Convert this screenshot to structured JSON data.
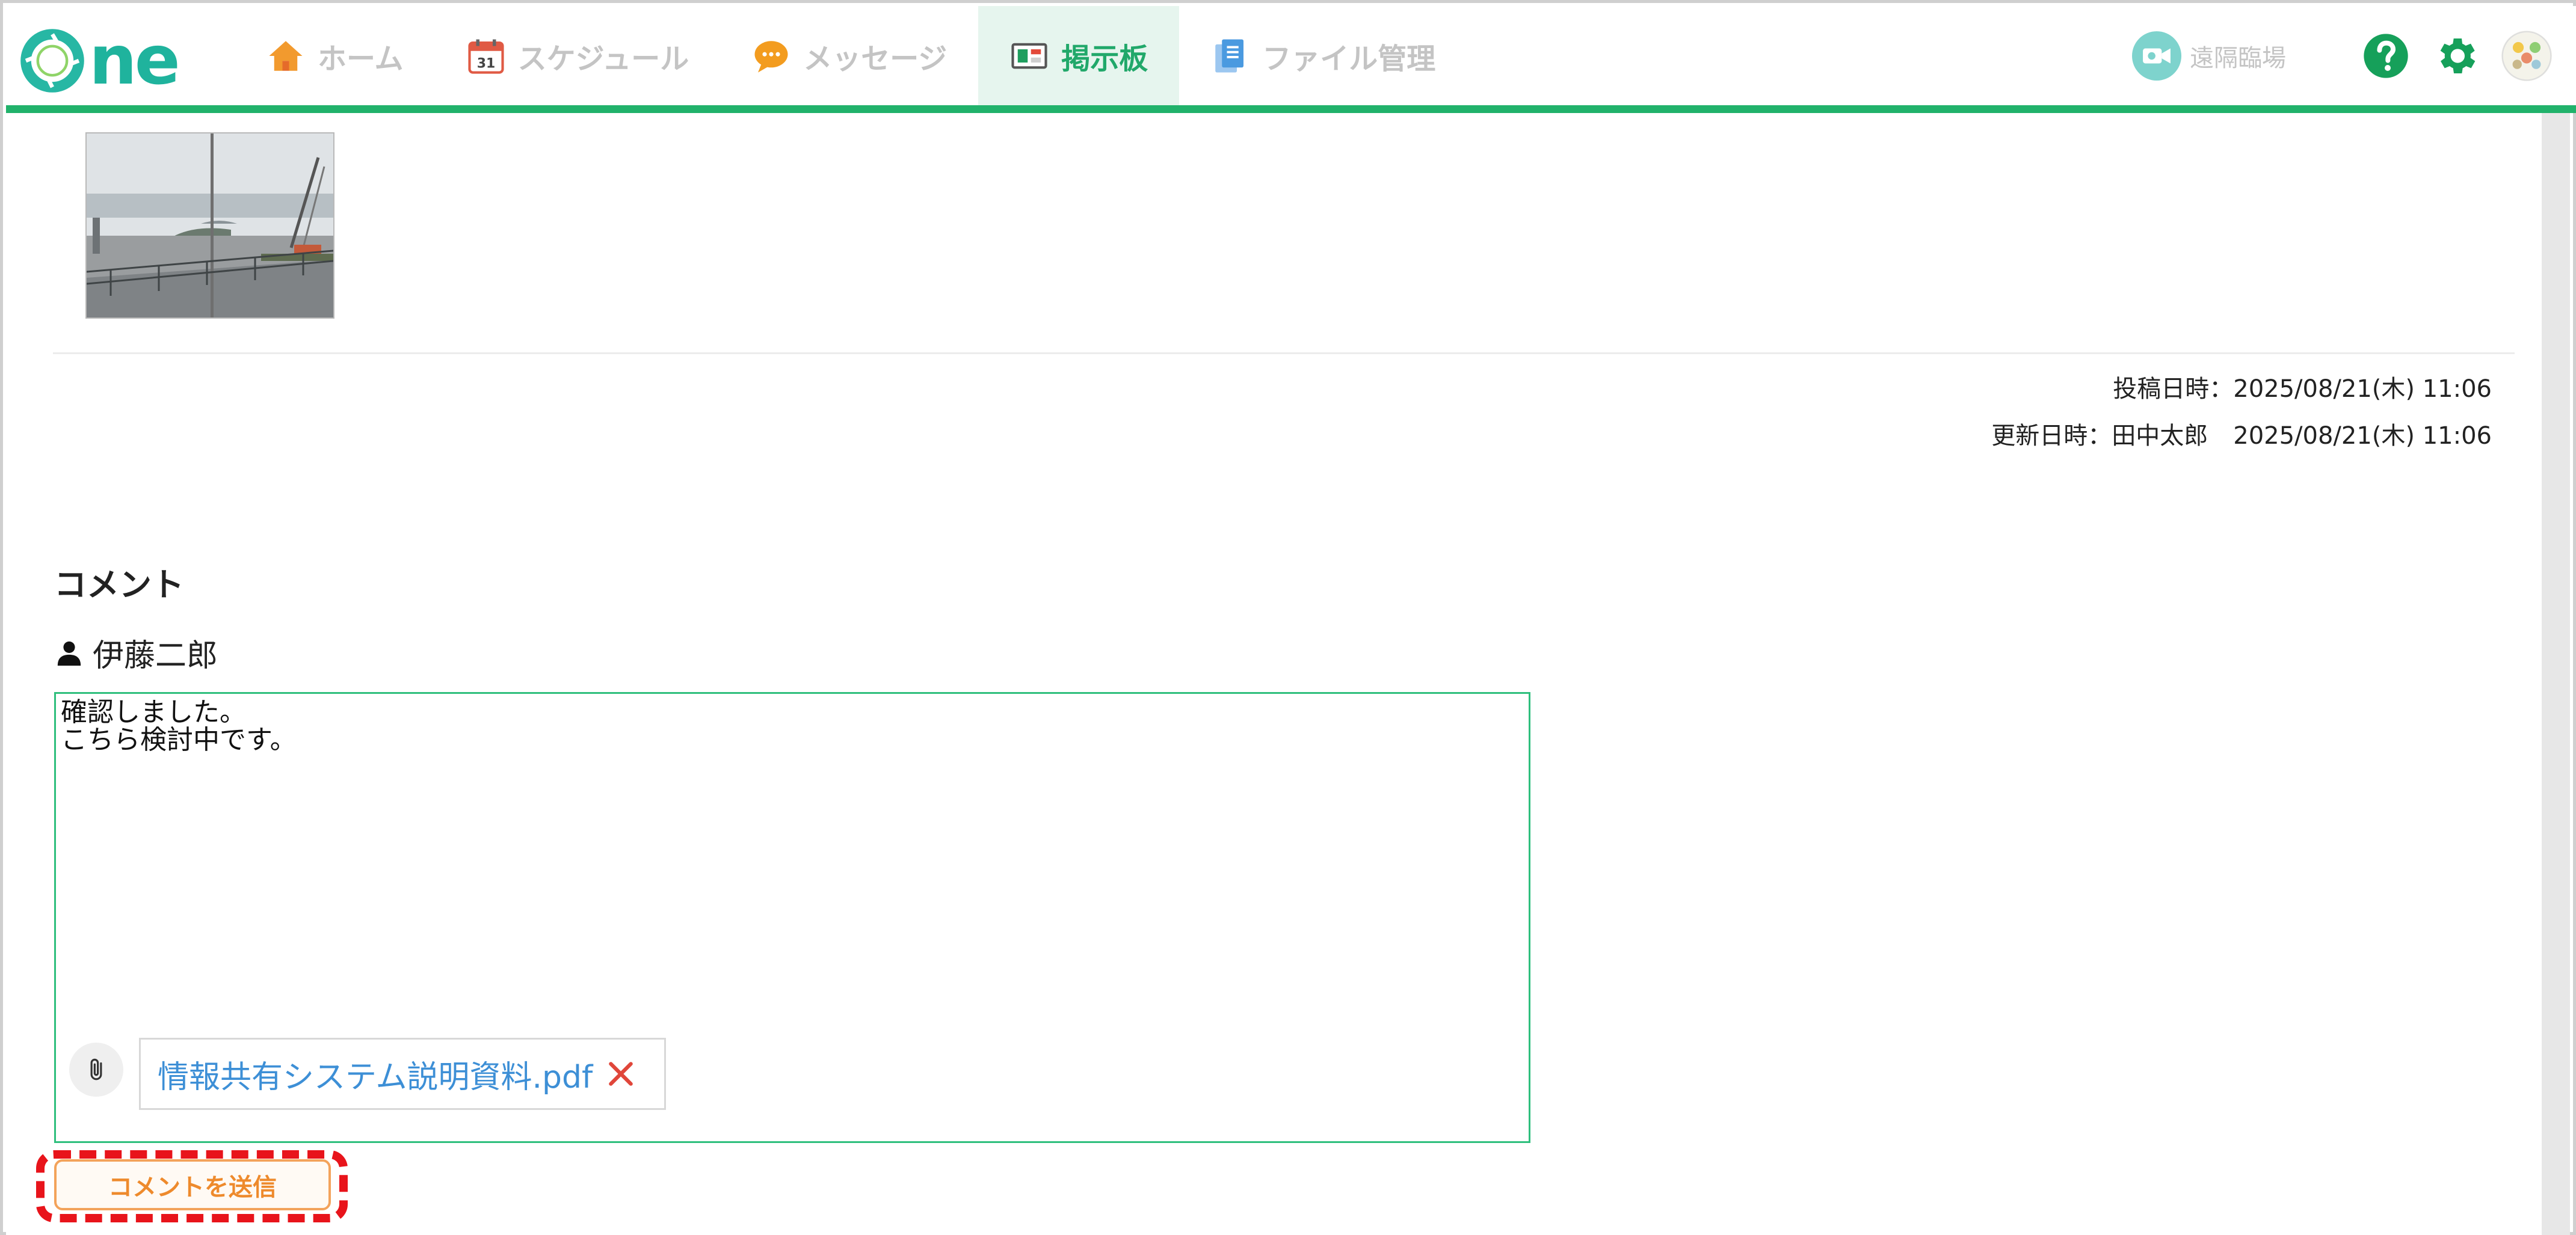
{
  "app": {
    "logo_text": "ne"
  },
  "nav": {
    "items": [
      {
        "label": "ホーム",
        "icon": "house-icon"
      },
      {
        "label": "スケジュール",
        "icon": "calendar-icon",
        "calendar_day": "31"
      },
      {
        "label": "メッセージ",
        "icon": "chat-bubble-icon"
      },
      {
        "label": "掲示板",
        "icon": "bulletin-board-icon",
        "active": true
      },
      {
        "label": "ファイル管理",
        "icon": "documents-icon"
      }
    ]
  },
  "header_tools": {
    "remote_label": "遠隔臨場",
    "remote_icon": "video-camera-icon",
    "help_icon": "question-circle-icon",
    "settings_icon": "gear-icon",
    "avatar_icon": "user-avatar-icon"
  },
  "post": {
    "posted_label": "投稿日時：",
    "posted_value": "2025/08/21(木) 11:06",
    "updated_label": "更新日時：",
    "updated_by": "田中太郎",
    "updated_value": "2025/08/21(木) 11:06"
  },
  "comments": {
    "section_title": "コメント",
    "author_name": "伊藤二郎",
    "draft_text": "確認しました。\nこちら検討中です。",
    "attachment_name": "情報共有システム説明資料.pdf",
    "send_label": "コメントを送信"
  },
  "colors": {
    "brand_green": "#21b26b",
    "link_blue": "#3d8fd6",
    "send_orange": "#ee8a2c",
    "highlight_red": "#e8141b"
  }
}
